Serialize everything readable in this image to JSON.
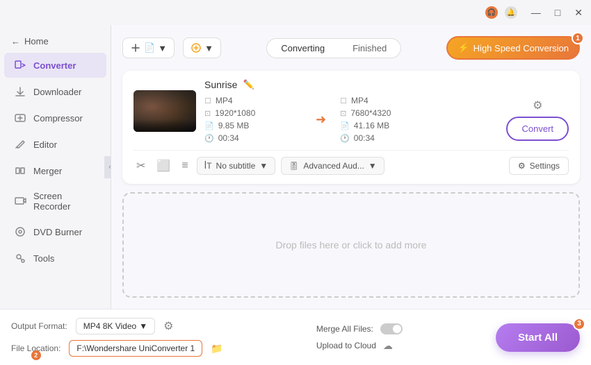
{
  "titlebar": {
    "icons": [
      "headphones-icon",
      "bell-icon"
    ],
    "controls": [
      "minimize",
      "maximize",
      "close"
    ],
    "minimize_label": "—",
    "maximize_label": "□",
    "close_label": "✕"
  },
  "sidebar": {
    "home_label": "Home",
    "items": [
      {
        "id": "converter",
        "label": "Converter",
        "active": true
      },
      {
        "id": "downloader",
        "label": "Downloader",
        "active": false
      },
      {
        "id": "compressor",
        "label": "Compressor",
        "active": false
      },
      {
        "id": "editor",
        "label": "Editor",
        "active": false
      },
      {
        "id": "merger",
        "label": "Merger",
        "active": false
      },
      {
        "id": "screen-recorder",
        "label": "Screen Recorder",
        "active": false
      },
      {
        "id": "dvd-burner",
        "label": "DVD Burner",
        "active": false
      },
      {
        "id": "tools",
        "label": "Tools",
        "active": false
      }
    ]
  },
  "toolbar": {
    "add_files_label": "▼",
    "add_option_label": "▼",
    "tabs": {
      "converting_label": "Converting",
      "finished_label": "Finished"
    },
    "high_speed_label": "High Speed Conversion",
    "high_speed_badge": "1"
  },
  "file_card": {
    "title": "Sunrise",
    "source": {
      "format": "MP4",
      "resolution": "1920*1080",
      "size": "9.85 MB",
      "duration": "00:34"
    },
    "dest": {
      "format": "MP4",
      "resolution": "7680*4320",
      "size": "41.16 MB",
      "duration": "00:34"
    },
    "convert_button_label": "Convert",
    "subtitle_label": "No subtitle",
    "audio_label": "Advanced Aud...",
    "settings_label": "Settings"
  },
  "bottom_bar": {
    "output_format_label": "Output Format:",
    "output_format_value": "MP4 8K Video",
    "file_location_label": "File Location:",
    "file_location_value": "F:\\Wondershare UniConverter 1",
    "file_location_badge": "2",
    "merge_label": "Merge All Files:",
    "upload_label": "Upload to Cloud",
    "start_all_label": "Start All",
    "start_all_badge": "3"
  }
}
